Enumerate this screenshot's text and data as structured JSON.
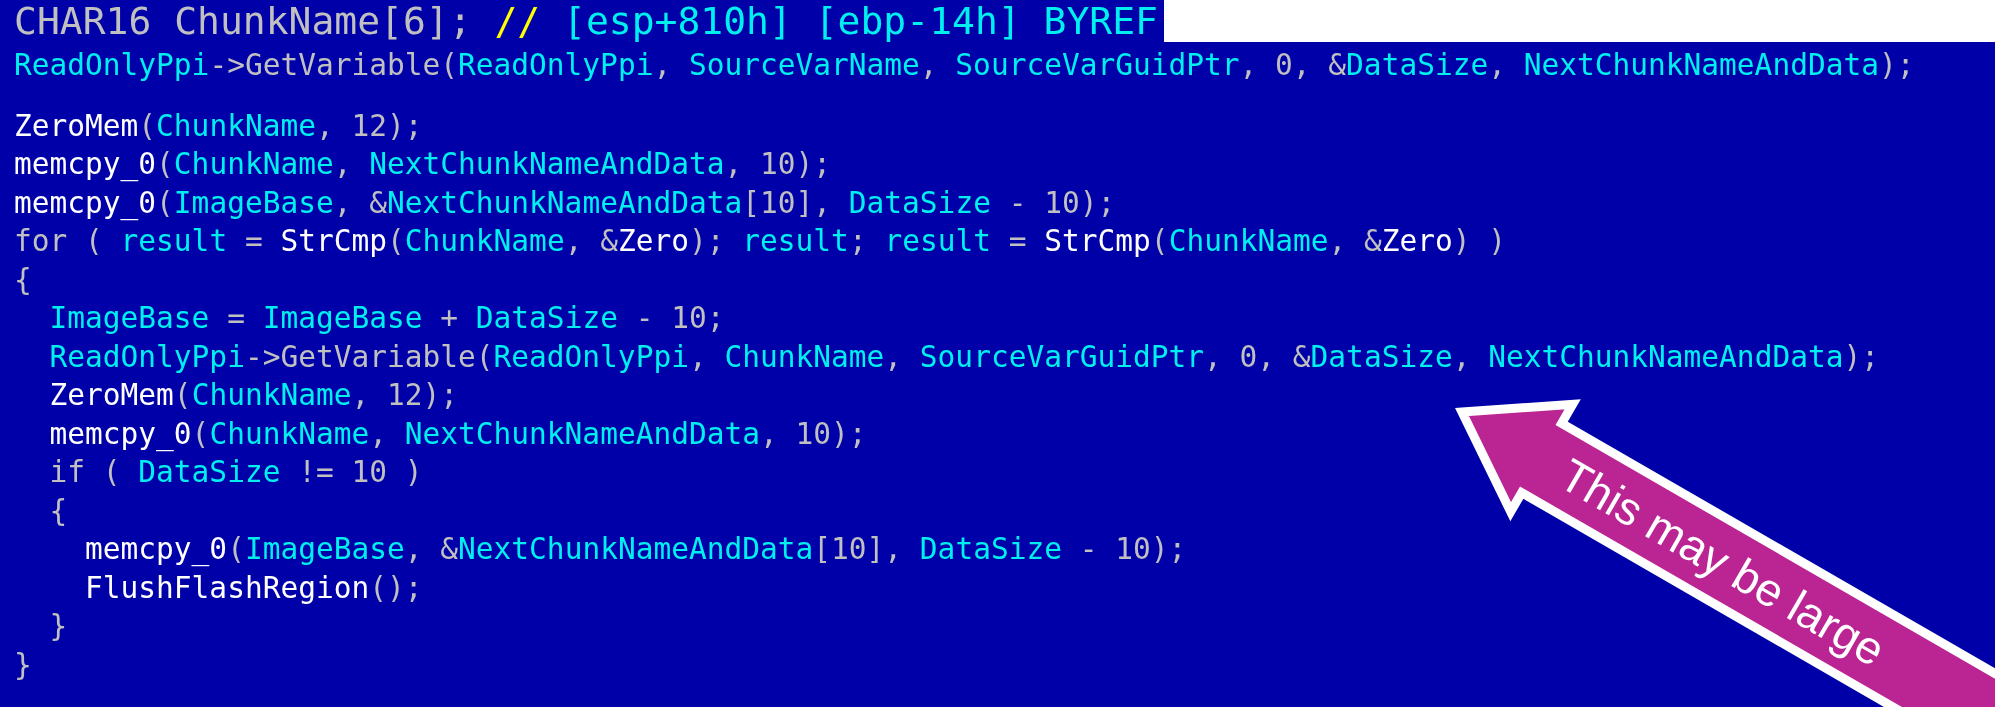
{
  "tooltip": {
    "tokens": [
      {
        "text": "CHAR16 ChunkName[6]; ",
        "kind": "plain"
      },
      {
        "text": "// ",
        "kind": "comment"
      },
      {
        "text": "[esp+810h] [ebp-14h] BYREF",
        "kind": "name"
      }
    ]
  },
  "code_lines": [
    {
      "tokens": [
        {
          "text": "ReadOnlyPpi",
          "kind": "name"
        },
        {
          "text": "->GetVariable(",
          "kind": "plain"
        },
        {
          "text": "ReadOnlyPpi",
          "kind": "name"
        },
        {
          "text": ", ",
          "kind": "plain"
        },
        {
          "text": "SourceVarName",
          "kind": "name"
        },
        {
          "text": ", ",
          "kind": "plain"
        },
        {
          "text": "SourceVarGuidPtr",
          "kind": "name"
        },
        {
          "text": ", 0, &",
          "kind": "plain"
        },
        {
          "text": "DataSize",
          "kind": "name"
        },
        {
          "text": ", ",
          "kind": "plain"
        },
        {
          "text": "NextChunkNameAndData",
          "kind": "name"
        },
        {
          "text": ");",
          "kind": "plain"
        }
      ]
    },
    {
      "tokens": [
        {
          "text": "ZeroMem",
          "kind": "func"
        },
        {
          "text": "(",
          "kind": "plain"
        },
        {
          "text": "ChunkName",
          "kind": "name"
        },
        {
          "text": ", 12);",
          "kind": "plain"
        }
      ]
    },
    {
      "tokens": [
        {
          "text": "memcpy_0",
          "kind": "func"
        },
        {
          "text": "(",
          "kind": "plain"
        },
        {
          "text": "ChunkName",
          "kind": "name"
        },
        {
          "text": ", ",
          "kind": "plain"
        },
        {
          "text": "NextChunkNameAndData",
          "kind": "name"
        },
        {
          "text": ", 10);",
          "kind": "plain"
        }
      ]
    },
    {
      "tokens": [
        {
          "text": "memcpy_0",
          "kind": "func"
        },
        {
          "text": "(",
          "kind": "plain"
        },
        {
          "text": "ImageBase",
          "kind": "name"
        },
        {
          "text": ", &",
          "kind": "plain"
        },
        {
          "text": "NextChunkNameAndData",
          "kind": "name"
        },
        {
          "text": "[10], ",
          "kind": "plain"
        },
        {
          "text": "DataSize",
          "kind": "name"
        },
        {
          "text": " - 10);",
          "kind": "plain"
        }
      ]
    },
    {
      "tokens": [
        {
          "text": "for ( ",
          "kind": "plain"
        },
        {
          "text": "result",
          "kind": "name"
        },
        {
          "text": " = ",
          "kind": "plain"
        },
        {
          "text": "StrCmp",
          "kind": "func"
        },
        {
          "text": "(",
          "kind": "plain"
        },
        {
          "text": "ChunkName",
          "kind": "name"
        },
        {
          "text": ", &",
          "kind": "plain"
        },
        {
          "text": "Zero",
          "kind": "func"
        },
        {
          "text": "); ",
          "kind": "plain"
        },
        {
          "text": "result",
          "kind": "name"
        },
        {
          "text": "; ",
          "kind": "plain"
        },
        {
          "text": "result",
          "kind": "name"
        },
        {
          "text": " = ",
          "kind": "plain"
        },
        {
          "text": "StrCmp",
          "kind": "func"
        },
        {
          "text": "(",
          "kind": "plain"
        },
        {
          "text": "ChunkName",
          "kind": "name"
        },
        {
          "text": ", &",
          "kind": "plain"
        },
        {
          "text": "Zero",
          "kind": "func"
        },
        {
          "text": ") )",
          "kind": "plain"
        }
      ]
    },
    {
      "tokens": [
        {
          "text": "{",
          "kind": "plain"
        }
      ]
    },
    {
      "tokens": [
        {
          "text": "  ImageBase",
          "kind": "name"
        },
        {
          "text": " = ",
          "kind": "plain"
        },
        {
          "text": "ImageBase",
          "kind": "name"
        },
        {
          "text": " + ",
          "kind": "plain"
        },
        {
          "text": "DataSize",
          "kind": "name"
        },
        {
          "text": " - 10;",
          "kind": "plain"
        }
      ]
    },
    {
      "tokens": [
        {
          "text": "  ReadOnlyPpi",
          "kind": "name"
        },
        {
          "text": "->GetVariable(",
          "kind": "plain"
        },
        {
          "text": "ReadOnlyPpi",
          "kind": "name"
        },
        {
          "text": ", ",
          "kind": "plain"
        },
        {
          "text": "ChunkName",
          "kind": "name"
        },
        {
          "text": ", ",
          "kind": "plain"
        },
        {
          "text": "SourceVarGuidPtr",
          "kind": "name"
        },
        {
          "text": ", 0, &",
          "kind": "plain"
        },
        {
          "text": "DataSize",
          "kind": "name"
        },
        {
          "text": ", ",
          "kind": "plain"
        },
        {
          "text": "NextChunkNameAndData",
          "kind": "name"
        },
        {
          "text": ");",
          "kind": "plain"
        }
      ]
    },
    {
      "tokens": [
        {
          "text": "  ZeroMem",
          "kind": "func"
        },
        {
          "text": "(",
          "kind": "plain"
        },
        {
          "text": "ChunkName",
          "kind": "name"
        },
        {
          "text": ", 12);",
          "kind": "plain"
        }
      ]
    },
    {
      "tokens": [
        {
          "text": "  memcpy_0",
          "kind": "func"
        },
        {
          "text": "(",
          "kind": "plain"
        },
        {
          "text": "ChunkName",
          "kind": "name"
        },
        {
          "text": ", ",
          "kind": "plain"
        },
        {
          "text": "NextChunkNameAndData",
          "kind": "name"
        },
        {
          "text": ", 10);",
          "kind": "plain"
        }
      ]
    },
    {
      "tokens": [
        {
          "text": "  if ( ",
          "kind": "plain"
        },
        {
          "text": "DataSize",
          "kind": "name"
        },
        {
          "text": " != 10 )",
          "kind": "plain"
        }
      ]
    },
    {
      "tokens": [
        {
          "text": "  {",
          "kind": "plain"
        }
      ]
    },
    {
      "tokens": [
        {
          "text": "    memcpy_0",
          "kind": "func"
        },
        {
          "text": "(",
          "kind": "plain"
        },
        {
          "text": "ImageBase",
          "kind": "name"
        },
        {
          "text": ", &",
          "kind": "plain"
        },
        {
          "text": "NextChunkNameAndData",
          "kind": "name"
        },
        {
          "text": "[10], ",
          "kind": "plain"
        },
        {
          "text": "DataSize",
          "kind": "name"
        },
        {
          "text": " - 10);",
          "kind": "plain"
        }
      ]
    },
    {
      "tokens": [
        {
          "text": "    FlushFlashRegion",
          "kind": "func"
        },
        {
          "text": "();",
          "kind": "plain"
        }
      ]
    },
    {
      "tokens": [
        {
          "text": "  }",
          "kind": "plain"
        }
      ]
    },
    {
      "tokens": [
        {
          "text": "}",
          "kind": "plain"
        }
      ]
    }
  ],
  "callout": {
    "text": "This may be large"
  }
}
